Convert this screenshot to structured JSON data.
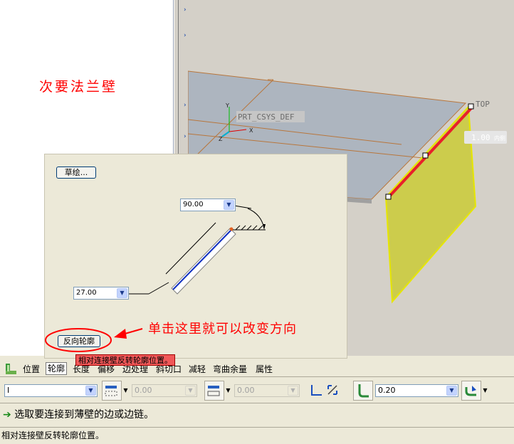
{
  "left_panel": {
    "title": "次要法兰壁"
  },
  "model_view": {
    "csys_label": "PRT_CSYS_DEF",
    "axis_y": "Y",
    "axis_x": "X",
    "axis_z": "Z",
    "plane_label": "TOP",
    "dim_value": "1.00",
    "dim_suffix": "内侧"
  },
  "dialog": {
    "sketch_button": "草绘...",
    "angle_value": "90.00",
    "length_value": "27.00",
    "flip_profile_button": "反向轮廓"
  },
  "annotation": "单击这里就可以改变方向",
  "tooltip": "相对连接壁反转轮廓位置。",
  "tabs": [
    {
      "label": "位置"
    },
    {
      "label": "轮廓"
    },
    {
      "label": "长度"
    },
    {
      "label": "偏移"
    },
    {
      "label": "边处理"
    },
    {
      "label": "斜切口"
    },
    {
      "label": "减轻"
    },
    {
      "label": "弯曲余量"
    },
    {
      "label": "属性"
    }
  ],
  "toolbar": {
    "profile_type": "I",
    "offset1": "0.00",
    "offset2": "0.00",
    "radius": "0.20"
  },
  "message": "选取要连接到薄壁的边或边链。",
  "status": "相对连接壁反转轮廓位置。",
  "colors": {
    "annotation": "#ff0000",
    "wall_fill": "#cccc4c",
    "edge_highlight": "#e8202a",
    "model_bg": "#d4d0c8"
  }
}
